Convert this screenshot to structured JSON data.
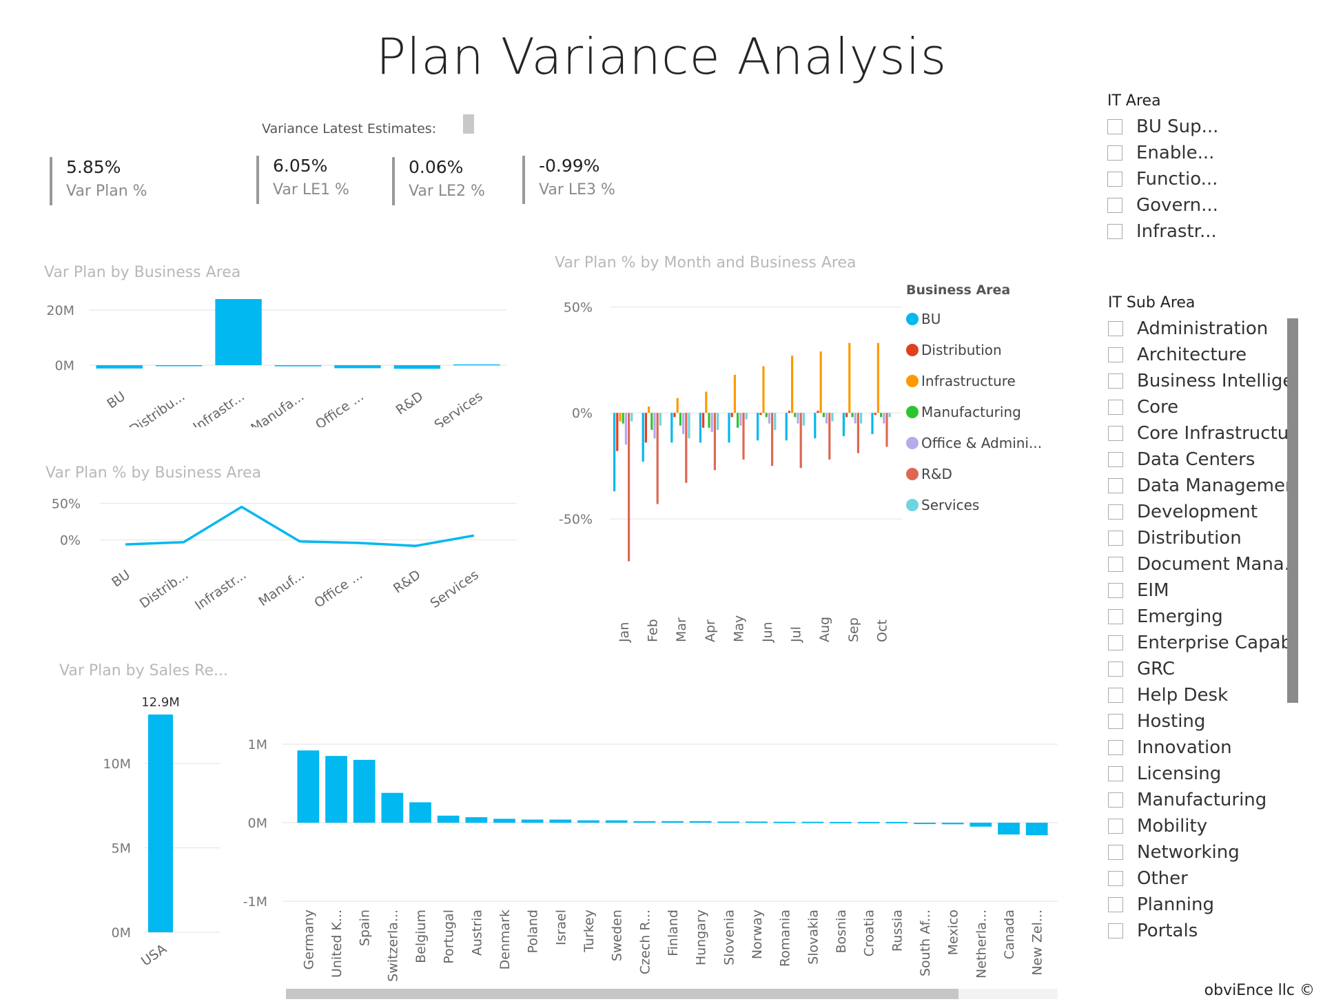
{
  "page": {
    "title": "Plan Variance Analysis"
  },
  "variance_header": "Variance Latest Estimates:",
  "kpis": [
    {
      "value": "5.85%",
      "label": "Var Plan %"
    },
    {
      "value": "6.05%",
      "label": "Var LE1 %"
    },
    {
      "value": "0.06%",
      "label": "Var LE2 %"
    },
    {
      "value": "-0.99%",
      "label": "Var LE3 %"
    }
  ],
  "slicers": {
    "it_area": {
      "title": "IT Area",
      "items": [
        "BU Sup...",
        "Enable...",
        "Functio...",
        "Govern...",
        "Infrastr..."
      ]
    },
    "it_sub_area": {
      "title": "IT Sub Area",
      "items": [
        "Administration",
        "Architecture",
        "Business Intellige...",
        "Core",
        "Core Infrastructure",
        "Data Centers",
        "Data Management",
        "Development",
        "Distribution",
        "Document Mana...",
        "EIM",
        "Emerging",
        "Enterprise Capabi...",
        "GRC",
        "Help Desk",
        "Hosting",
        "Innovation",
        "Licensing",
        "Manufacturing",
        "Mobility",
        "Networking",
        "Other",
        "Planning",
        "Portals"
      ]
    }
  },
  "colors": {
    "primary": "#01b8f0",
    "series": [
      "#01b8f0",
      "#e0401e",
      "#fd9a00",
      "#2bc530",
      "#b8a9ea",
      "#de6754",
      "#6dd5e0"
    ]
  },
  "footer": "obviEnce llc ©",
  "chart_data": [
    {
      "id": "var-plan-by-business-area",
      "type": "bar",
      "title": "Var Plan by Business Area",
      "categories": [
        "BU",
        "Distribu...",
        "Infrastr...",
        "Manufa...",
        "Office ...",
        "R&D",
        "Services"
      ],
      "values": [
        -1.2,
        -0.3,
        24.0,
        -0.4,
        -1.1,
        -1.3,
        0.3
      ],
      "ticks": [
        "20M",
        "0M"
      ],
      "tick_values": [
        20,
        0
      ],
      "ylim": [
        -5,
        25
      ],
      "unit": "M"
    },
    {
      "id": "var-plan-pct-by-business-area",
      "type": "line",
      "title": "Var Plan % by Business Area",
      "categories": [
        "BU",
        "Distrib...",
        "Infrastr...",
        "Manuf...",
        "Office ...",
        "R&D",
        "Services"
      ],
      "values": [
        -6,
        -3,
        45,
        -2,
        -4,
        -8,
        6
      ],
      "ticks": [
        "50%",
        "0%"
      ],
      "tick_values": [
        50,
        0
      ],
      "ylim": [
        -20,
        55
      ]
    },
    {
      "id": "var-plan-pct-by-month-and-business-area",
      "type": "bar",
      "title": "Var Plan % by Month and Business Area",
      "legend_title": "Business Area",
      "categories": [
        "Jan",
        "Feb",
        "Mar",
        "Apr",
        "May",
        "Jun",
        "Jul",
        "Aug",
        "Sep",
        "Oct"
      ],
      "ticks": [
        "50%",
        "0%",
        "-50%"
      ],
      "tick_values": [
        50,
        0,
        -50
      ],
      "ylim": [
        -75,
        55
      ],
      "series": [
        {
          "name": "BU",
          "values": [
            -37,
            -23,
            -14,
            -14,
            -14,
            -13,
            -13,
            -12,
            -11,
            -10
          ]
        },
        {
          "name": "Distribution",
          "values": [
            -18,
            -14,
            -2,
            -7,
            -2,
            -1,
            1,
            1,
            -2,
            -1
          ]
        },
        {
          "name": "Infrastructure",
          "values": [
            -4,
            3,
            7,
            10,
            18,
            22,
            27,
            29,
            33,
            33
          ]
        },
        {
          "name": "Manufacturing",
          "values": [
            -5,
            -8,
            -6,
            -7,
            -7,
            -2,
            -2,
            -2,
            -2,
            -2
          ]
        },
        {
          "name": "Office & Admini...",
          "values": [
            -15,
            -12,
            -10,
            -9,
            -6,
            -5,
            -5,
            -5,
            -5,
            -5
          ]
        },
        {
          "name": "R&D",
          "values": [
            -70,
            -43,
            -33,
            -27,
            -22,
            -25,
            -26,
            -22,
            -19,
            -16
          ]
        },
        {
          "name": "Services",
          "values": [
            -4,
            -6,
            -12,
            -8,
            -3,
            -8,
            -6,
            -4,
            -5,
            -2
          ]
        }
      ]
    },
    {
      "id": "var-plan-by-sales-region-usa",
      "type": "bar",
      "title": "Var Plan by Sales Re...",
      "categories": [
        "USA"
      ],
      "values": [
        12.9
      ],
      "data_labels": [
        "12.9M"
      ],
      "ticks": [
        "10M",
        "5M",
        "0M"
      ],
      "tick_values": [
        10,
        5,
        0
      ],
      "ylim": [
        0,
        14
      ],
      "unit": "M"
    },
    {
      "id": "var-plan-by-sales-region-countries",
      "type": "bar",
      "categories": [
        "Germany",
        "United K...",
        "Spain",
        "Switzerla...",
        "Belgium",
        "Portugal",
        "Austria",
        "Denmark",
        "Poland",
        "Israel",
        "Turkey",
        "Sweden",
        "Czech R...",
        "Finland",
        "Hungary",
        "Slovenia",
        "Norway",
        "Romania",
        "Slovakia",
        "Bosnia",
        "Croatia",
        "Russia",
        "South Af...",
        "Mexico",
        "Netherla...",
        "Canada",
        "New Zel..."
      ],
      "values": [
        0.92,
        0.85,
        0.8,
        0.38,
        0.26,
        0.09,
        0.07,
        0.05,
        0.04,
        0.04,
        0.03,
        0.03,
        0.02,
        0.02,
        0.02,
        0.015,
        0.015,
        0.012,
        0.012,
        0.01,
        0.01,
        0.01,
        -0.01,
        -0.02,
        -0.05,
        -0.15,
        -0.16
      ],
      "ticks": [
        "1M",
        "0M",
        "-1M"
      ],
      "tick_values": [
        1,
        0,
        -1
      ],
      "ylim": [
        -1,
        1
      ],
      "unit": "M"
    }
  ]
}
